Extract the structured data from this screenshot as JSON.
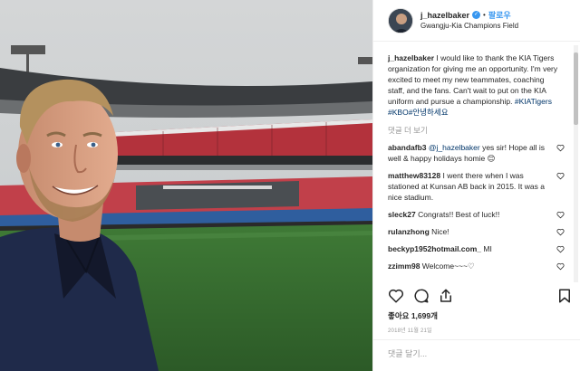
{
  "header": {
    "username": "j_hazelbaker",
    "verified_glyph": "✓",
    "separator": "•",
    "follow_label": "팔로우",
    "location": "Gwangju-Kia Champions Field"
  },
  "caption": {
    "username": "j_hazelbaker",
    "text": "I would like to thank the KIA Tigers organization for giving me an opportunity. I'm very excited to meet my new teammates, coaching staff, and the fans. Can't wait to put on the KIA uniform and pursue a championship.",
    "hashtags": [
      "#KIATigers",
      "#KBO",
      "#안녕하세요"
    ]
  },
  "more_comments_label": "댓글 더 보기",
  "comments": [
    {
      "username": "abandafb3",
      "mention": "@j_hazelbaker",
      "text": " yes sir! Hope all is well & happy holidays homie 😊"
    },
    {
      "username": "matthew83128",
      "mention": "",
      "text": " I went there when I was stationed at Kunsan AB back in 2015. It was a nice stadium."
    },
    {
      "username": "sleck27",
      "mention": "",
      "text": " Congrats!! Best of luck!!"
    },
    {
      "username": "rulanzhong",
      "mention": "",
      "text": " Nice!"
    },
    {
      "username": "beckyp1952hotmail.com_",
      "mention": "",
      "text": " MI"
    },
    {
      "username": "zzimm98",
      "mention": "",
      "text": " Welcome~~~♡"
    }
  ],
  "icons": {
    "like": "heart-icon",
    "comment": "comment-icon",
    "share": "share-icon",
    "save": "bookmark-icon"
  },
  "likes_text": "좋아요 1,699개",
  "date_text": "2018년 11월 21일",
  "comment_input": {
    "placeholder": "댓글 달기..."
  },
  "colors": {
    "link": "#003569",
    "accent": "#3897f0",
    "muted": "#999999"
  }
}
